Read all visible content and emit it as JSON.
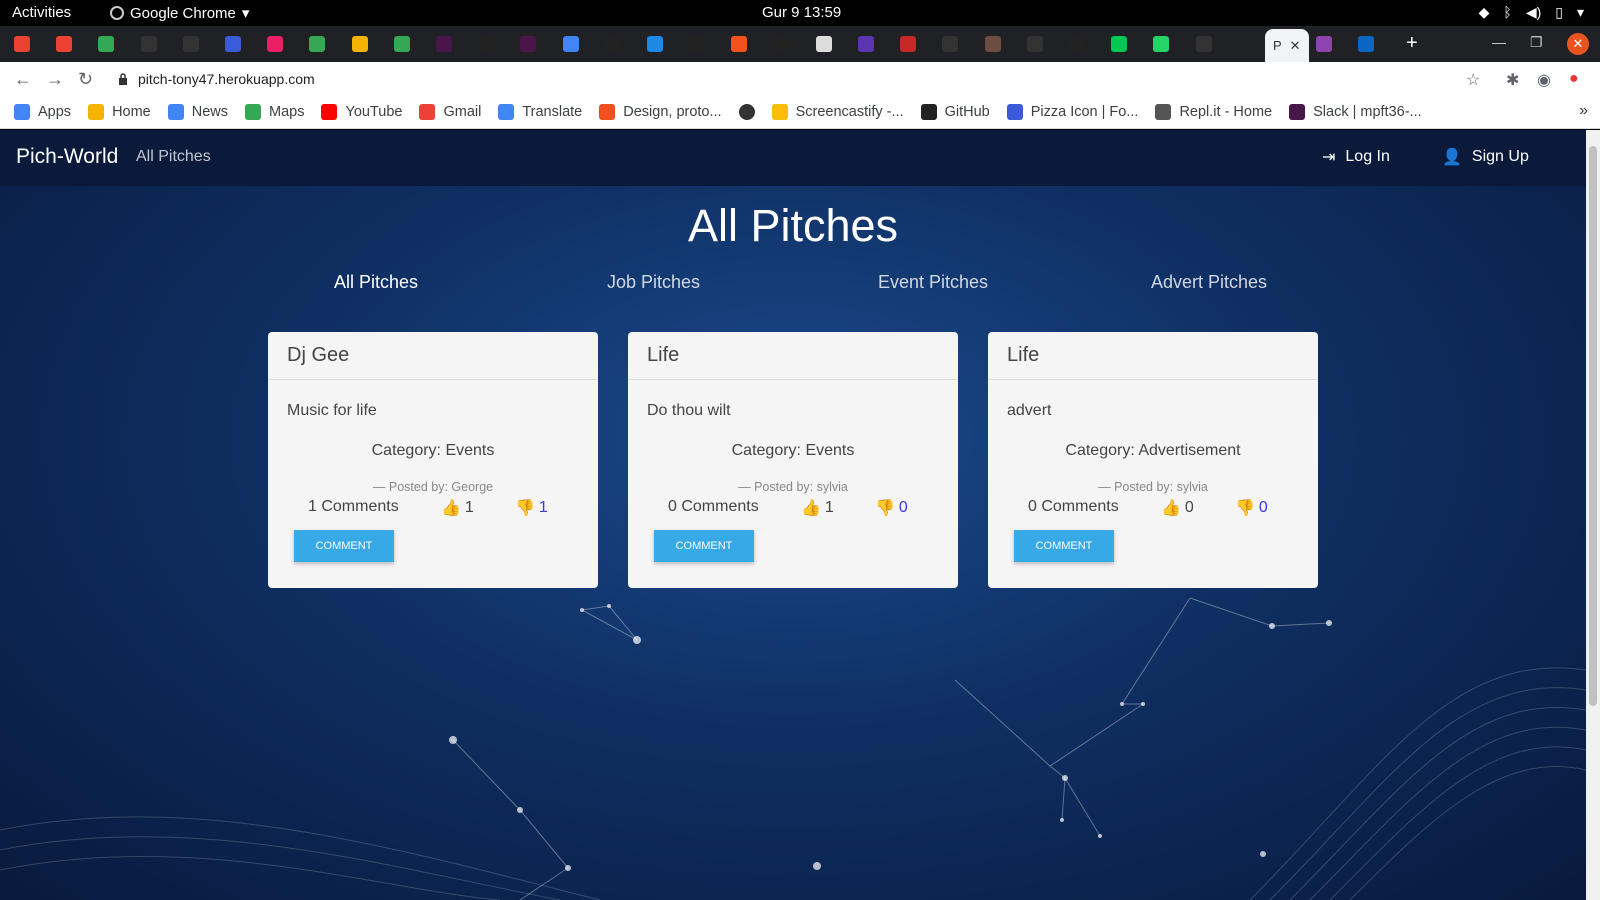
{
  "system": {
    "activities": "Activities",
    "app_name": "Google Chrome",
    "clock": "Gur 9  13:59"
  },
  "browser": {
    "active_tab_letter": "P",
    "url": "pitch-tony47.herokuapp.com",
    "bookmarks": [
      {
        "label": "Apps",
        "color": "#4285f4"
      },
      {
        "label": "Home",
        "color": "#f4b400"
      },
      {
        "label": "News",
        "color": "#4285f4"
      },
      {
        "label": "Maps",
        "color": "#34a853"
      },
      {
        "label": "YouTube",
        "color": "#ff0000"
      },
      {
        "label": "Gmail",
        "color": "#ea4335"
      },
      {
        "label": "Translate",
        "color": "#4285f4"
      },
      {
        "label": "Design, proto...",
        "color": "#f24e1e"
      },
      {
        "label": "",
        "color": "#333333"
      },
      {
        "label": "Screencastify -...",
        "color": "#fbbc05"
      },
      {
        "label": "GitHub",
        "color": "#222222"
      },
      {
        "label": "Pizza Icon | Fo...",
        "color": "#3b5bdb"
      },
      {
        "label": "Repl.it - Home",
        "color": "#555555"
      },
      {
        "label": "Slack | mpft36-...",
        "color": "#4a154b"
      }
    ]
  },
  "site": {
    "brand": "Pich-World",
    "nav_all": "All Pitches",
    "login": "Log In",
    "signup": "Sign Up",
    "title": "All Pitches",
    "categories": [
      "All Pitches",
      "Job Pitches",
      "Event Pitches",
      "Advert Pitches"
    ],
    "pitches": [
      {
        "title": "Dj Gee",
        "description": "Music for life",
        "category": "Category: Events",
        "posted_by": "— Posted by: George",
        "comments": "1 Comments",
        "upvotes": "1",
        "downvotes": "1",
        "button": "COMMENT"
      },
      {
        "title": "Life",
        "description": "Do thou wilt",
        "category": "Category: Events",
        "posted_by": "— Posted by: sylvia",
        "comments": "0 Comments",
        "upvotes": "1",
        "downvotes": "0",
        "button": "COMMENT"
      },
      {
        "title": "Life",
        "description": "advert",
        "category": "Category: Advertisement",
        "posted_by": "— Posted by: sylvia",
        "comments": "0 Comments",
        "upvotes": "0",
        "downvotes": "0",
        "button": "COMMENT"
      }
    ]
  },
  "colors": {
    "upvote": "#1a9c1a",
    "downvote": "#e00000",
    "button": "#36a9e6"
  }
}
